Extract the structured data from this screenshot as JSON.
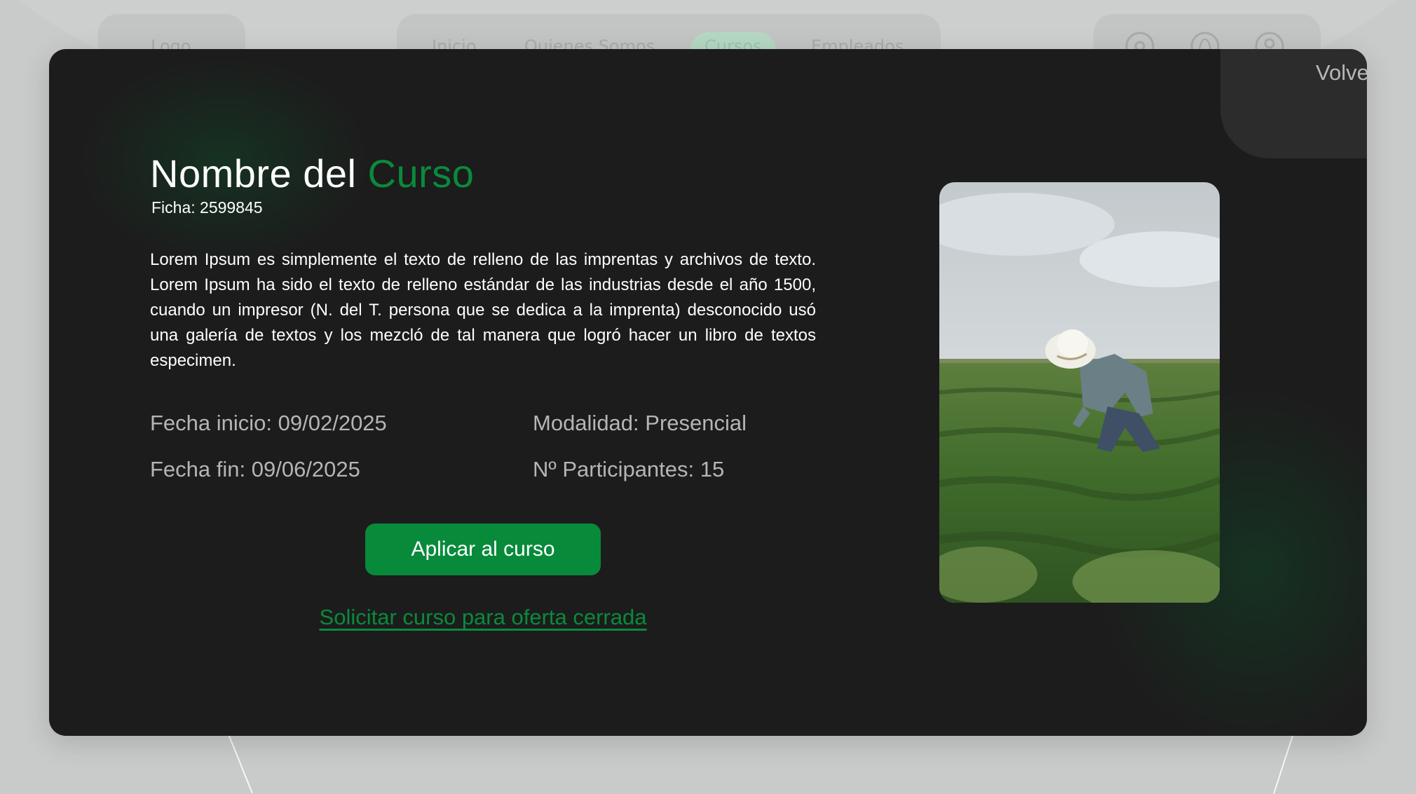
{
  "background_page": {
    "logo": "Logo",
    "nav": [
      {
        "label": "Inicio"
      },
      {
        "label": "Quienes Somos"
      },
      {
        "label": "Cursos",
        "active": true
      },
      {
        "label": "Empleados"
      }
    ],
    "icons": [
      "settings-icon",
      "bell-icon",
      "user-icon"
    ]
  },
  "modal": {
    "back_label": "Volver",
    "title_main": "Nombre del ",
    "title_accent": "Curso",
    "ficha": "Ficha: 2599845",
    "description": "Lorem Ipsum es simplemente el texto de relleno de las imprentas y archivos de texto. Lorem Ipsum ha sido el texto de relleno estándar de las industrias desde el año 1500, cuando un impresor (N. del T. persona que se dedica a la imprenta) desconocido usó una galería de textos y los mezcló de tal manera que logró hacer un libro de textos especimen.",
    "fecha_inicio": "Fecha inicio: 09/02/2025",
    "fecha_fin": "Fecha fin: 09/06/2025",
    "modalidad": "Modalidad: Presencial",
    "participantes": "Nº Participantes: 15",
    "apply_label": "Aplicar al curso",
    "closed_offer_label": "Solicitar curso para oferta cerrada",
    "image_icon": "farmer-in-field-photo"
  },
  "colors": {
    "accent": "#0a8a3c",
    "modal_bg": "#1c1c1c",
    "page_bg": "#c9caca"
  }
}
